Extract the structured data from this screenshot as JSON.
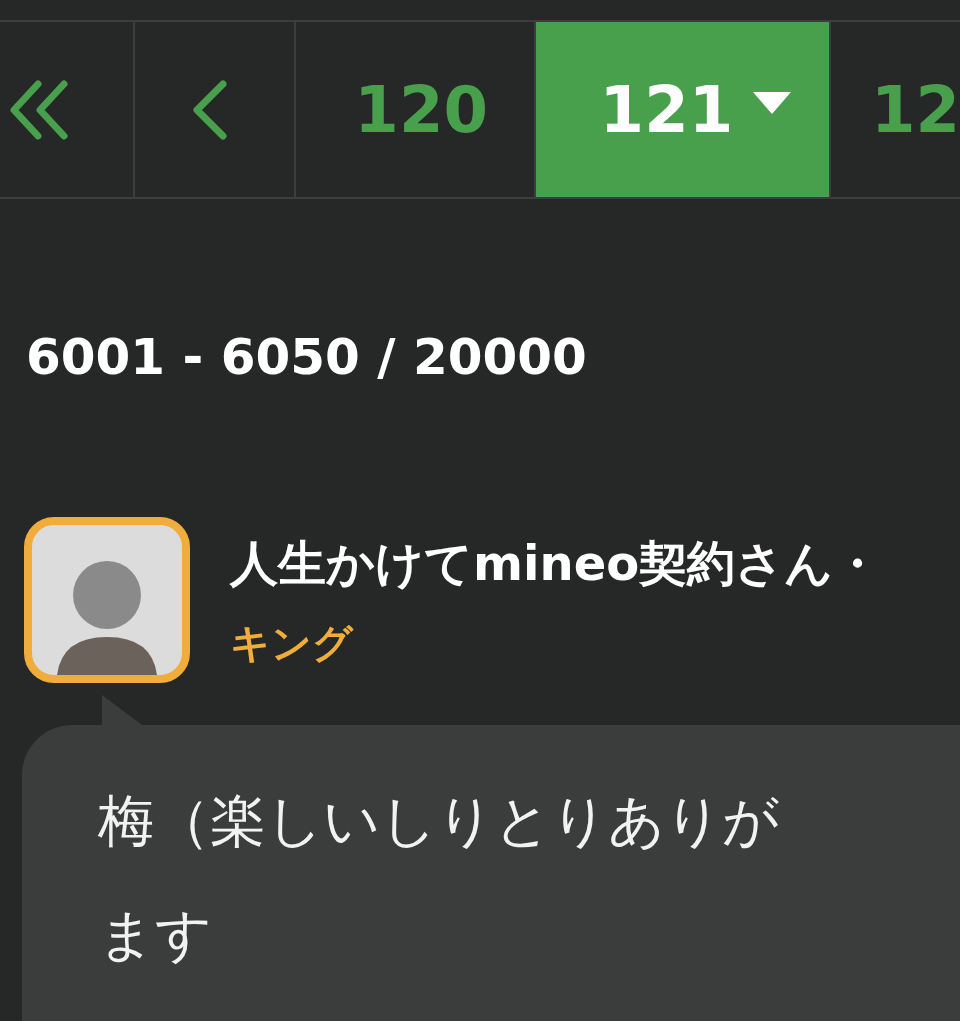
{
  "pagination": [
    {
      "kind": "first",
      "selected": false
    },
    {
      "kind": "prev",
      "selected": false
    },
    {
      "kind": "page",
      "label": "120",
      "selected": false
    },
    {
      "kind": "page",
      "label": "121",
      "selected": true
    },
    {
      "kind": "page",
      "label": "12",
      "selected": false
    }
  ],
  "range": "6001 - 6050 / 20000",
  "post": {
    "author": "人生かけてmineo契約さん・",
    "rank": "キング",
    "lines": [
      "梅（楽しいしりとりありが",
      "ます"
    ]
  }
}
